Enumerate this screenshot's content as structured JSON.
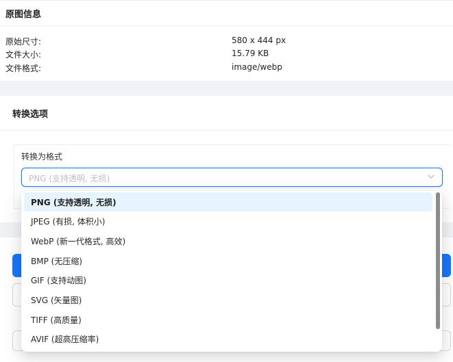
{
  "original_info": {
    "title": "原图信息",
    "rows": [
      {
        "label": "原始尺寸:",
        "value": "580 x 444 px"
      },
      {
        "label": "文件大小:",
        "value": "15.79 KB"
      },
      {
        "label": "文件格式:",
        "value": "image/webp"
      }
    ]
  },
  "convert": {
    "title": "转换选项",
    "format_label": "转换为格式",
    "select_placeholder": "PNG (支持透明, 无损)",
    "options": [
      "PNG (支持透明, 无损)",
      "JPEG (有损, 体积小)",
      "WebP (新一代格式, 高效)",
      "BMP (无压缩)",
      "GIF (支持动图)",
      "SVG (矢量图)",
      "TIFF (高质量)",
      "AVIF (超高压缩率)"
    ],
    "selected_index": 0
  },
  "icons": {
    "select_arrow": "chevron-down-icon"
  },
  "colors": {
    "accent": "#1677ff",
    "selected_bg": "#e6f4ff"
  }
}
